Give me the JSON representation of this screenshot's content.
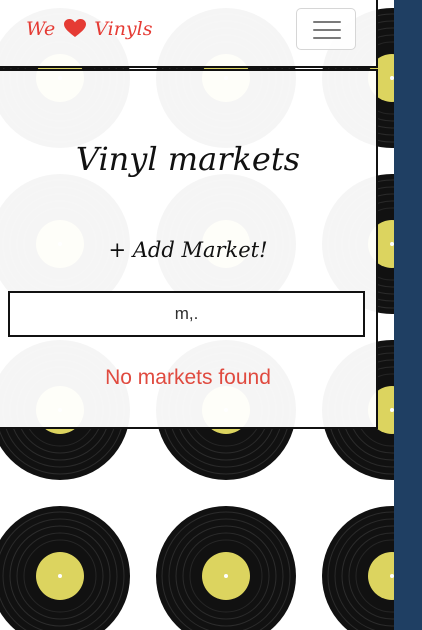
{
  "header": {
    "brand_left": "We",
    "brand_right": "Vinyls",
    "heart_icon": "heart-icon",
    "menu_icon": "hamburger-menu-icon"
  },
  "main": {
    "title": "Vinyl markets",
    "add_market_label": "+ Add Market!",
    "search_value": "m,.",
    "empty_message": "No markets found"
  },
  "colors": {
    "brand": "#e53b34",
    "accent_rail": "#1f3f63",
    "empty_state": "#e04a3f",
    "record_label": "#dcd45f"
  }
}
